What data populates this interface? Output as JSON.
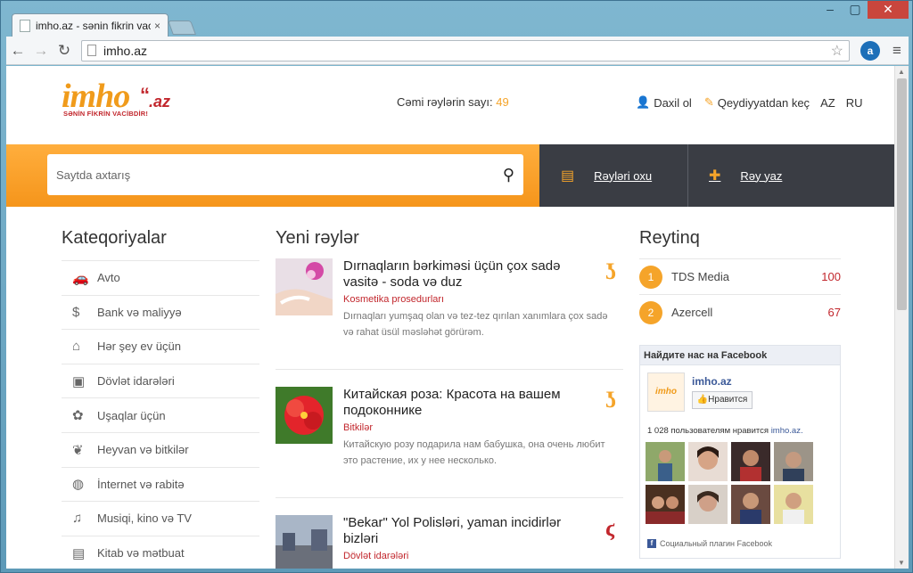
{
  "browser": {
    "tab_title": "imho.az - sənin fikrin vacil",
    "tab_close": "×",
    "url": "imho.az",
    "window_controls": [
      "–",
      "▢",
      "✕"
    ],
    "star": "☆",
    "ext": "a",
    "menu": "≡",
    "back": "←",
    "forward": "→",
    "reload": "↻"
  },
  "site": {
    "logo": {
      "word": "imho",
      "az": ".az",
      "tagline": "SƏNİN FİKRİN VACİBDİR!",
      "quote": "“"
    },
    "count_label": "Cəmi rəylərin sayı:",
    "count_value": "49",
    "login": "Daxil ol",
    "register": "Qeydiyyatdan keç",
    "lang_az": "AZ",
    "lang_ru": "RU"
  },
  "banner": {
    "search_placeholder": "Saytda axtarış",
    "read_label": "Rəyləri oxu",
    "write_label": "Rəy yaz"
  },
  "categories": {
    "heading": "Kateqoriyalar",
    "items": [
      {
        "label": "Avto",
        "icon": "car-icon",
        "glyph": "🚗"
      },
      {
        "label": "Bank və maliyyə",
        "icon": "dollar-icon",
        "glyph": "$"
      },
      {
        "label": "Hər şey ev üçün",
        "icon": "home-icon",
        "glyph": "⌂"
      },
      {
        "label": "Dövlət idarələri",
        "icon": "briefcase-icon",
        "glyph": "▣"
      },
      {
        "label": "Uşaqlar üçün",
        "icon": "teddy-bear-icon",
        "glyph": "✿"
      },
      {
        "label": "Heyvan və bitkilər",
        "icon": "plant-icon",
        "glyph": "❦"
      },
      {
        "label": "İnternet və rabitə",
        "icon": "globe-icon",
        "glyph": "◍"
      },
      {
        "label": "Musiqi, kino və TV",
        "icon": "music-icon",
        "glyph": "♫"
      },
      {
        "label": "Kitab və mətbuat",
        "icon": "book-icon",
        "glyph": "▤"
      }
    ]
  },
  "posts": {
    "heading": "Yeni rəylər",
    "items": [
      {
        "title": "Dırnaqların bərkiməsi üçün çox sadə vasitə - soda və duz",
        "category": "Kosmetika prosedurları",
        "description": "Dırnaqları yumşaq olan və tez-tez qırılan xanımlara çox sadə və rahat üsül məsləhət görürəm.",
        "mark_color": "#f5a42a",
        "mark": "ʖ"
      },
      {
        "title": "Китайская роза: Красота на вашем подоконнике",
        "category": "Bitkilər",
        "description": "Китайскую розу подарила нам бабушка, она очень любит это растение, их у нее несколько.",
        "mark_color": "#f5a42a",
        "mark": "ʖ"
      },
      {
        "title": "\"Bekar\" Yol Polisləri, yaman incidirlər bizləri",
        "category": "Dövlət idarələri",
        "description": "",
        "mark_color": "#c2272d",
        "mark": "ϛ"
      }
    ]
  },
  "rating": {
    "heading": "Reytinq",
    "items": [
      {
        "rank": "1",
        "name": "TDS Media",
        "value": "100"
      },
      {
        "rank": "2",
        "name": "Azercell",
        "value": "67"
      }
    ]
  },
  "facebook": {
    "header": "Найдите нас на Facebook",
    "page_name": "imho.az",
    "page_thumb": "imho",
    "like_label": "👍Нравится",
    "fans_text": "1 028 пользователям нравится ",
    "fans_link": "imho.az.",
    "plugin_label": "Социальный плагин Facebook",
    "plugin_icon": "f"
  }
}
